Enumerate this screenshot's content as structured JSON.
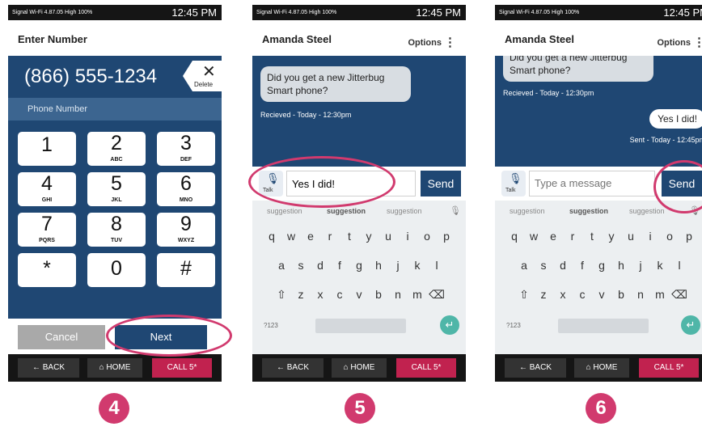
{
  "status": {
    "left": "Signal  Wi-Fi  4.87.05  High  100%",
    "time": "12:45 PM"
  },
  "phone1": {
    "title": "Enter Number",
    "number": "(866) 555-1234",
    "delete_icon": "close-icon",
    "delete_label": "Delete",
    "phone_label": "Phone Number",
    "keys": [
      {
        "d": "1",
        "l": ""
      },
      {
        "d": "2",
        "l": "ABC"
      },
      {
        "d": "3",
        "l": "DEF"
      },
      {
        "d": "4",
        "l": "GHI"
      },
      {
        "d": "5",
        "l": "JKL"
      },
      {
        "d": "6",
        "l": "MNO"
      },
      {
        "d": "7",
        "l": "PQRS"
      },
      {
        "d": "8",
        "l": "TUV"
      },
      {
        "d": "9",
        "l": "WXYZ"
      },
      {
        "d": "*",
        "l": ""
      },
      {
        "d": "0",
        "l": ""
      },
      {
        "d": "#",
        "l": ""
      }
    ],
    "cancel": "Cancel",
    "next": "Next"
  },
  "nav": {
    "back": "← BACK",
    "home": "⌂ HOME",
    "call": "CALL 5*"
  },
  "chat": {
    "contact": "Amanda Steel",
    "options": "Options",
    "incoming": "Did you get a new Jitterbug Smart phone?",
    "received": "Recieved - Today - 12:30pm",
    "outgoing": "Yes I did!",
    "sent": "Sent - Today - 12:45pm",
    "talk": "Talk",
    "input5": "Yes I did!",
    "placeholder6": "Type a message",
    "send": "Send",
    "suggestions": [
      "suggestion",
      "suggestion",
      "suggestion"
    ]
  },
  "keyboard": {
    "row1": [
      "q",
      "w",
      "e",
      "r",
      "t",
      "y",
      "u",
      "i",
      "o",
      "p"
    ],
    "row2": [
      "a",
      "s",
      "d",
      "f",
      "g",
      "h",
      "j",
      "k",
      "l"
    ],
    "row3": [
      "z",
      "x",
      "c",
      "v",
      "b",
      "n",
      "m"
    ],
    "sym": "?123"
  },
  "steps": [
    "4",
    "5",
    "6"
  ],
  "colors": {
    "navy": "#1f4773",
    "accent": "#d13a6e",
    "call": "#c1224f"
  }
}
